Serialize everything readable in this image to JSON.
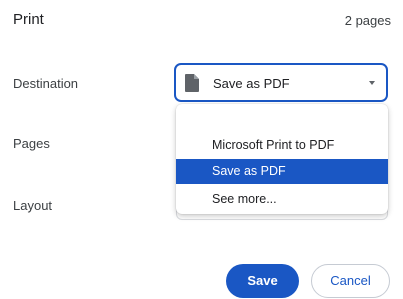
{
  "dialog": {
    "title": "Print",
    "page_count": "2 pages"
  },
  "rows": {
    "destination_label": "Destination",
    "pages_label": "Pages",
    "layout_label": "Layout"
  },
  "destination": {
    "selected": "Save as PDF",
    "icon": "document-icon",
    "options": [
      "Microsoft Print to PDF",
      "Save as PDF",
      "See more..."
    ],
    "highlighted_option": "Save as PDF"
  },
  "buttons": {
    "save": "Save",
    "cancel": "Cancel"
  },
  "colors": {
    "accent": "#1a57c4",
    "highlight_text": "#ffffff"
  }
}
